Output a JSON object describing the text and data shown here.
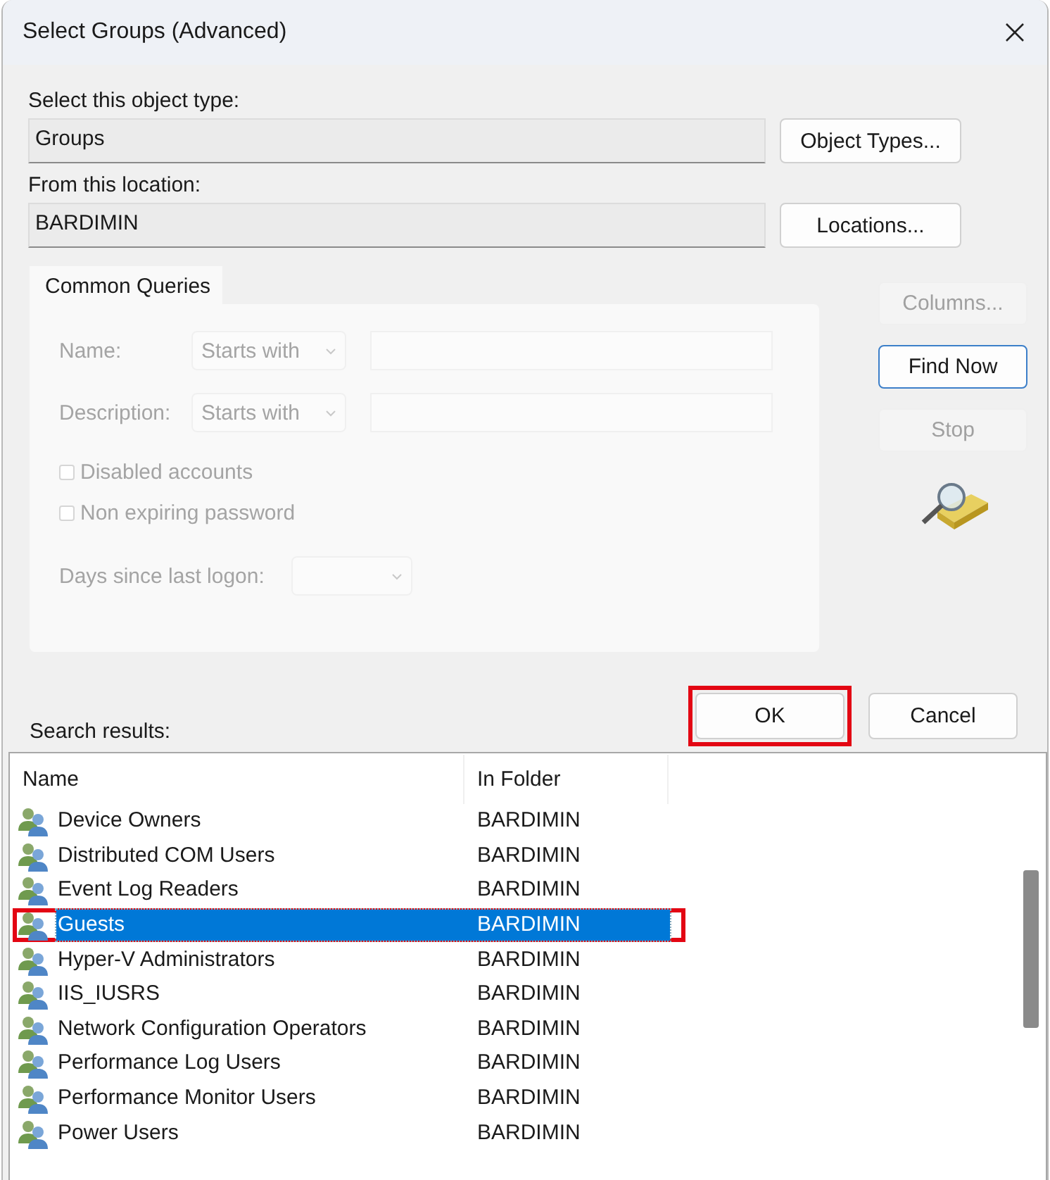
{
  "window": {
    "title": "Select Groups (Advanced)"
  },
  "object_type": {
    "label": "Select this object type:",
    "value": "Groups",
    "button": "Object Types..."
  },
  "location": {
    "label": "From this location:",
    "value": "BARDIMIN",
    "button": "Locations..."
  },
  "query_tab": {
    "label": "Common Queries"
  },
  "query": {
    "fields": [
      {
        "label": "Name:",
        "mode": "Starts with",
        "disabled": true
      },
      {
        "label": "Description:",
        "mode": "Starts with",
        "disabled": true
      }
    ],
    "checkboxes": [
      {
        "label": "Disabled accounts",
        "checked": false,
        "disabled": true
      },
      {
        "label": "Non expiring password",
        "checked": false,
        "disabled": true
      }
    ],
    "days": {
      "label": "Days since last logon:",
      "disabled": true
    }
  },
  "side_buttons": [
    {
      "label": "Columns...",
      "disabled": true,
      "default": false
    },
    {
      "label": "Find Now",
      "disabled": false,
      "default": true
    },
    {
      "label": "Stop",
      "disabled": true,
      "default": false
    }
  ],
  "search_results_label": "Search results:",
  "dialog_buttons": [
    {
      "label": "OK",
      "highlighted": true
    },
    {
      "label": "Cancel",
      "highlighted": false
    }
  ],
  "table": {
    "columns": [
      "Name",
      "In Folder"
    ],
    "rows": [
      {
        "name": "Device Owners",
        "folder": "BARDIMIN",
        "selected": false,
        "highlighted": false
      },
      {
        "name": "Distributed COM Users",
        "folder": "BARDIMIN",
        "selected": false,
        "highlighted": false
      },
      {
        "name": "Event Log Readers",
        "folder": "BARDIMIN",
        "selected": false,
        "highlighted": false
      },
      {
        "name": "Guests",
        "folder": "BARDIMIN",
        "selected": true,
        "highlighted": true
      },
      {
        "name": "Hyper-V Administrators",
        "folder": "BARDIMIN",
        "selected": false,
        "highlighted": false
      },
      {
        "name": "IIS_IUSRS",
        "folder": "BARDIMIN",
        "selected": false,
        "highlighted": false
      },
      {
        "name": "Network Configuration Operators",
        "folder": "BARDIMIN",
        "selected": false,
        "highlighted": false
      },
      {
        "name": "Performance Log Users",
        "folder": "BARDIMIN",
        "selected": false,
        "highlighted": false
      },
      {
        "name": "Performance Monitor Users",
        "folder": "BARDIMIN",
        "selected": false,
        "highlighted": false
      },
      {
        "name": "Power Users",
        "folder": "BARDIMIN",
        "selected": false,
        "highlighted": false
      }
    ]
  }
}
